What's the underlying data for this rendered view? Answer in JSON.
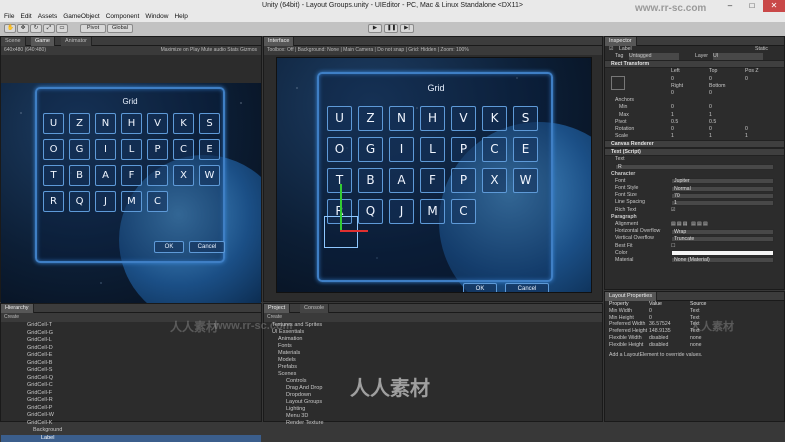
{
  "window": {
    "title": "Unity (64bit) - Layout Groups.unity - UIEditor - PC, Mac & Linux Standalone <DX11>"
  },
  "menu": [
    "File",
    "Edit",
    "Assets",
    "GameObject",
    "Component",
    "Window",
    "Help"
  ],
  "toolbar": {
    "pivot": "Pivot",
    "global": "Global"
  },
  "scene_panel": {
    "tabs": [
      "Scene",
      "Game",
      "Animator"
    ],
    "subbar": "640x480 (640:480)",
    "subbar_right": "Maximize on Play  Mute audio  Stats  Gizmos"
  },
  "interface_panel": {
    "tabs": [
      "Interface"
    ],
    "subbar": "Toolbox:  Off  |  Background:  None  |  Main Camera  |  Do not snap  |  Grid:  Hidden  |  Zoom:  100%"
  },
  "grid_ui": {
    "title": "Grid",
    "rows": [
      [
        "U",
        "Z",
        "N",
        "H",
        "V",
        "K",
        "S"
      ],
      [
        "O",
        "G",
        "I",
        "L",
        "P",
        "C",
        "E"
      ],
      [
        "T",
        "B",
        "A",
        "F",
        "P",
        "X",
        "W"
      ],
      [
        "R",
        "Q",
        "J",
        "M",
        "C"
      ]
    ],
    "ok": "OK",
    "cancel": "Cancel"
  },
  "inspector": {
    "tab": "Inspector",
    "object_name": "Label",
    "tag_label": "Tag",
    "tag_value": "Untagged",
    "layer_label": "Layer",
    "layer_value": "UI",
    "static": "Static",
    "rect_transform": "Rect Transform",
    "left_label": "Left",
    "top_label": "Top",
    "posz_label": "Pos Z",
    "right_label": "Right",
    "bottom_label": "Bottom",
    "anchors": "Anchors",
    "min": "Min",
    "max": "Max",
    "pivot": "Pivot",
    "rotation": "Rotation",
    "scale": "Scale",
    "vals": {
      "left": "0",
      "top": "0",
      "posz": "0",
      "right": "0",
      "bottom": "0",
      "min_x": "0",
      "min_y": "0",
      "max_x": "1",
      "max_y": "1",
      "pivot_x": "0.5",
      "pivot_y": "0.5",
      "rot_x": "0",
      "rot_y": "0",
      "rot_z": "0",
      "scale_x": "1",
      "scale_y": "1",
      "scale_z": "1"
    },
    "canvas_renderer": "Canvas Renderer",
    "text_script": "Text (Script)",
    "text_label": "Text",
    "text_value": "R",
    "character": "Character",
    "font_label": "Font",
    "font_value": "Jupiter",
    "font_style_label": "Font Style",
    "font_style_value": "Normal",
    "font_size_label": "Font Size",
    "font_size_value": "70",
    "line_spacing_label": "Line Spacing",
    "line_spacing_value": "1",
    "rich_text_label": "Rich Text",
    "paragraph": "Paragraph",
    "alignment_label": "Alignment",
    "h_overflow_label": "Horizontal Overflow",
    "h_overflow_value": "Wrap",
    "v_overflow_label": "Vertical Overflow",
    "v_overflow_value": "Truncate",
    "best_fit_label": "Best Fit",
    "color_label": "Color",
    "material_label": "Material",
    "material_value": "None (Material)"
  },
  "layout_properties": {
    "tab": "Layout Properties",
    "headers": [
      "Property",
      "Value",
      "Source"
    ],
    "rows": [
      [
        "Min Width",
        "0",
        "Text"
      ],
      [
        "Min Height",
        "0",
        "Text"
      ],
      [
        "Preferred Width",
        "36.57524",
        "Text"
      ],
      [
        "Preferred Height",
        "148.9135",
        "Text"
      ],
      [
        "Flexible Width",
        "disabled",
        "none"
      ],
      [
        "Flexible Height",
        "disabled",
        "none"
      ]
    ],
    "note": "Add a LayoutElement to override values."
  },
  "hierarchy": {
    "tab": "Hierarchy",
    "create": "Create",
    "items": [
      "GridCell-T",
      "GridCell-G",
      "GridCell-L",
      "GridCell-D",
      "GridCell-E",
      "GridCell-B",
      "GridCell-S",
      "GridCell-Q",
      "GridCell-C",
      "GridCell-F",
      "GridCell-R",
      "GridCell-P",
      "GridCell-W",
      "GridCell-K"
    ],
    "background": "Background",
    "label": "Label"
  },
  "project": {
    "tabs": [
      "Project",
      "Console"
    ],
    "create": "Create",
    "items": [
      "Textures and Sprites",
      "UI Essentials",
      "Animation",
      "Fonts",
      "Materials",
      "Models",
      "Prefabs",
      "Scenes",
      "Controls",
      "Drag And Drop",
      "Dropdown",
      "Layout Groups",
      "Lighting",
      "Menu 3D",
      "Render Texture"
    ]
  },
  "watermark": {
    "url": "www.rr-sc.com",
    "logo_cn": "人人素材"
  },
  "colors": {
    "accent": "#3f7fc5",
    "selection": "#3b5e8c",
    "background": "#383838"
  }
}
